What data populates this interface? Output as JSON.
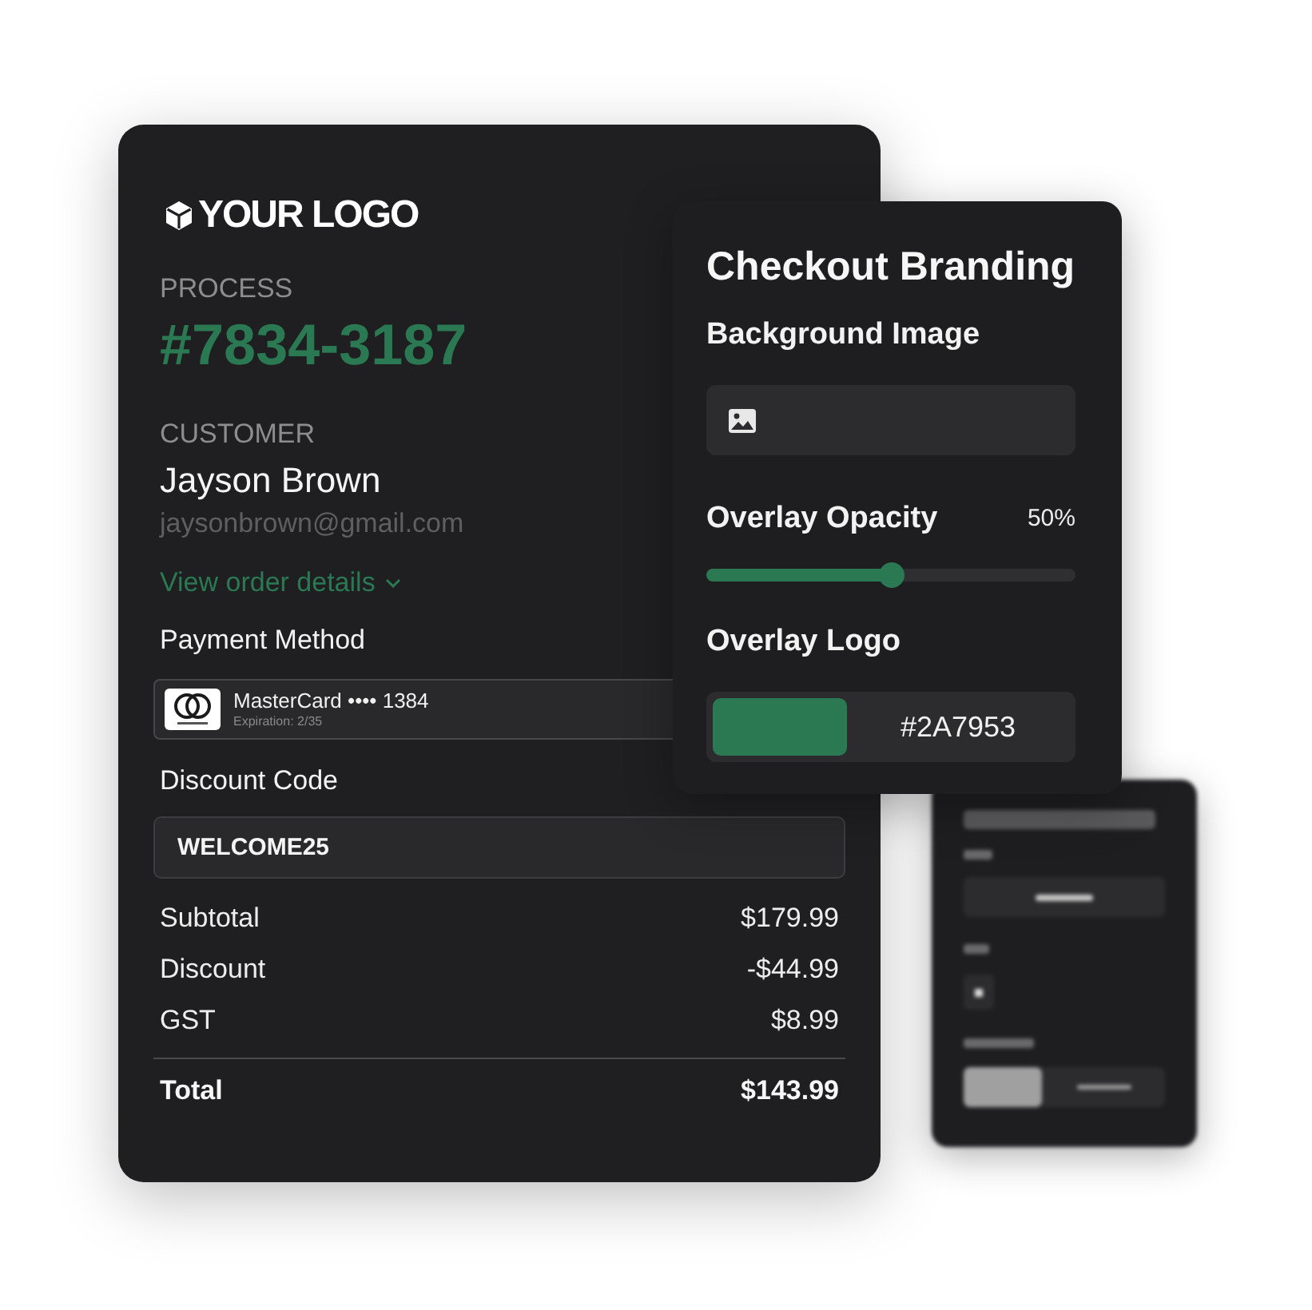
{
  "order_card": {
    "logo": "YOUR LOGO",
    "process_label": "PROCESS",
    "process_number": "#7834-3187",
    "customer_label": "CUSTOMER",
    "customer_name": "Jayson Brown",
    "customer_email": "jaysonbrown@gmail.com",
    "details_link": "View order details",
    "payment": {
      "label": "Payment Method",
      "card": "MasterCard •••• 1384",
      "expiry": "Expiration: 2/35"
    },
    "discount": {
      "label": "Discount Code",
      "value": "WELCOME25"
    },
    "summary": [
      {
        "kind": "line",
        "label": "Subtotal",
        "amount": "$179.99"
      },
      {
        "kind": "line",
        "label": "Discount",
        "amount": "-$44.99"
      },
      {
        "kind": "line",
        "label": "GST",
        "amount": "$8.99"
      },
      {
        "kind": "total",
        "label": "Total",
        "amount": "$143.99"
      }
    ]
  },
  "checkout_branding": {
    "title": "Checkout Branding",
    "background_image": {
      "label": "Background Image"
    },
    "overlay_opacity": {
      "label": "Overlay Opacity",
      "reading": "50%",
      "level": 0.5
    },
    "overlay_logo": {
      "label": "Overlay Logo",
      "color": "#2a7953",
      "value": "#2A7953"
    }
  }
}
